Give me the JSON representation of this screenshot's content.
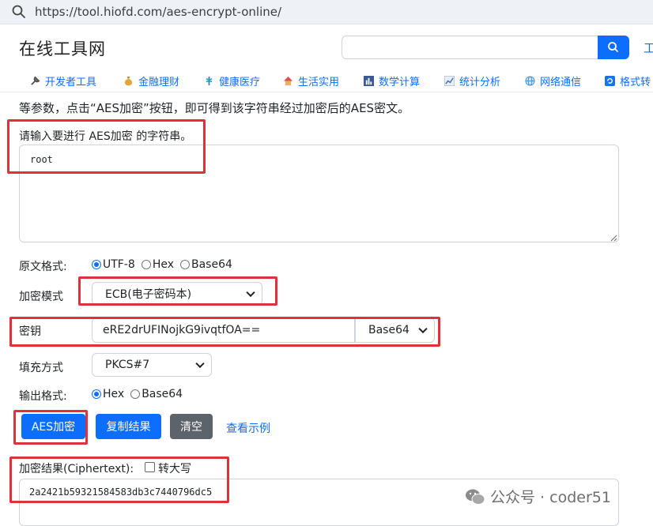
{
  "browser": {
    "url": "https://tool.hiofd.com/aes-encrypt-online/"
  },
  "site": {
    "title": "在线工具网",
    "search_placeholder": "",
    "header_cut": "工"
  },
  "nav": [
    {
      "icon": "wrench-icon",
      "label": "开发者工具"
    },
    {
      "icon": "money-bag-icon",
      "label": "金融理财"
    },
    {
      "icon": "caduceus-icon",
      "label": "健康医疗"
    },
    {
      "icon": "house-icon",
      "label": "生活实用"
    },
    {
      "icon": "bar-chart-icon",
      "label": "数学计算"
    },
    {
      "icon": "line-chart-icon",
      "label": "统计分析"
    },
    {
      "icon": "globe-icon",
      "label": "网络通信"
    },
    {
      "icon": "refresh-icon",
      "label": "格式转"
    }
  ],
  "description": "等参数，点击“AES加密”按钮，即可得到该字符串经过加密后的AES密文。",
  "input": {
    "label": "请输入要进行 AES加密 的字符串。",
    "value": "root"
  },
  "plaintext_format": {
    "label": "原文格式:",
    "options": [
      "UTF-8",
      "Hex",
      "Base64"
    ],
    "selected": "UTF-8"
  },
  "mode": {
    "label": "加密模式",
    "value": "ECB(电子密码本)"
  },
  "key": {
    "label": "密钥",
    "value": "eRE2drUFINojkG9ivqtfOA==",
    "encoding": "Base64"
  },
  "padding": {
    "label": "填充方式",
    "value": "PKCS#7"
  },
  "output_format": {
    "label": "输出格式:",
    "options": [
      "Hex",
      "Base64"
    ],
    "selected": "Hex"
  },
  "buttons": {
    "encrypt": "AES加密",
    "copy": "复制结果",
    "clear": "清空",
    "example": "查看示例"
  },
  "result": {
    "label": "加密结果(Ciphertext):",
    "uppercase_label": "转大写",
    "uppercase_checked": false,
    "value": "2a2421b59321584583db3c7440796dc5"
  },
  "watermark": {
    "text": "公众号 · coder51"
  },
  "colors": {
    "accent": "#0d6efd",
    "highlight": "#e0303a",
    "gray_button": "#5c636a"
  }
}
